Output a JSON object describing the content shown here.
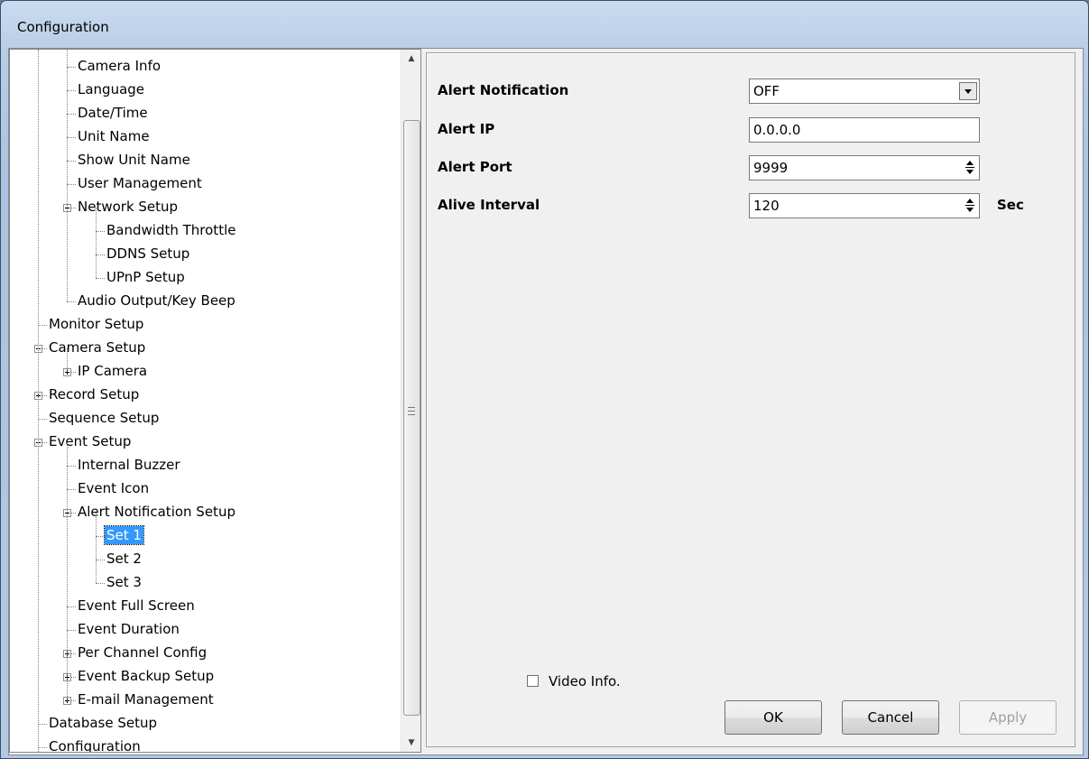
{
  "window": {
    "title": "Configuration"
  },
  "tree": {
    "nodes": [
      {
        "label": "Camera Info",
        "level": 2,
        "expander": "none"
      },
      {
        "label": "Language",
        "level": 2,
        "expander": "none"
      },
      {
        "label": "Date/Time",
        "level": 2,
        "expander": "none"
      },
      {
        "label": "Unit Name",
        "level": 2,
        "expander": "none"
      },
      {
        "label": "Show Unit Name",
        "level": 2,
        "expander": "none"
      },
      {
        "label": "User Management",
        "level": 2,
        "expander": "none"
      },
      {
        "label": "Network Setup",
        "level": 2,
        "expander": "minus"
      },
      {
        "label": "Bandwidth Throttle",
        "level": 3,
        "expander": "none"
      },
      {
        "label": "DDNS Setup",
        "level": 3,
        "expander": "none"
      },
      {
        "label": "UPnP Setup",
        "level": 3,
        "expander": "none"
      },
      {
        "label": "Audio Output/Key Beep",
        "level": 2,
        "expander": "none"
      },
      {
        "label": "Monitor Setup",
        "level": 1,
        "expander": "none"
      },
      {
        "label": "Camera Setup",
        "level": 1,
        "expander": "minus"
      },
      {
        "label": "IP Camera",
        "level": 2,
        "expander": "plus"
      },
      {
        "label": "Record Setup",
        "level": 1,
        "expander": "plus"
      },
      {
        "label": "Sequence Setup",
        "level": 1,
        "expander": "none"
      },
      {
        "label": "Event Setup",
        "level": 1,
        "expander": "minus"
      },
      {
        "label": "Internal Buzzer",
        "level": 2,
        "expander": "none"
      },
      {
        "label": "Event Icon",
        "level": 2,
        "expander": "none"
      },
      {
        "label": "Alert Notification Setup",
        "level": 2,
        "expander": "minus"
      },
      {
        "label": "Set 1",
        "level": 3,
        "expander": "none",
        "selected": true
      },
      {
        "label": "Set 2",
        "level": 3,
        "expander": "none"
      },
      {
        "label": "Set 3",
        "level": 3,
        "expander": "none"
      },
      {
        "label": "Event Full Screen",
        "level": 2,
        "expander": "none"
      },
      {
        "label": "Event Duration",
        "level": 2,
        "expander": "none"
      },
      {
        "label": "Per Channel Config",
        "level": 2,
        "expander": "plus"
      },
      {
        "label": "Event Backup Setup",
        "level": 2,
        "expander": "plus"
      },
      {
        "label": "E-mail Management",
        "level": 2,
        "expander": "plus"
      },
      {
        "label": "Database Setup",
        "level": 1,
        "expander": "none"
      },
      {
        "label": "Configuration",
        "level": 1,
        "expander": "none"
      }
    ]
  },
  "form": {
    "alert_notification": {
      "label": "Alert Notification",
      "value": "OFF"
    },
    "alert_ip": {
      "label": "Alert IP",
      "value": "0.0.0.0"
    },
    "alert_port": {
      "label": "Alert Port",
      "value": "9999"
    },
    "alive_interval": {
      "label": "Alive Interval",
      "value": "120",
      "unit": "Sec"
    }
  },
  "video_info": {
    "label": "Video Info.",
    "checked": false
  },
  "buttons": {
    "ok": "OK",
    "cancel": "Cancel",
    "apply": "Apply"
  }
}
